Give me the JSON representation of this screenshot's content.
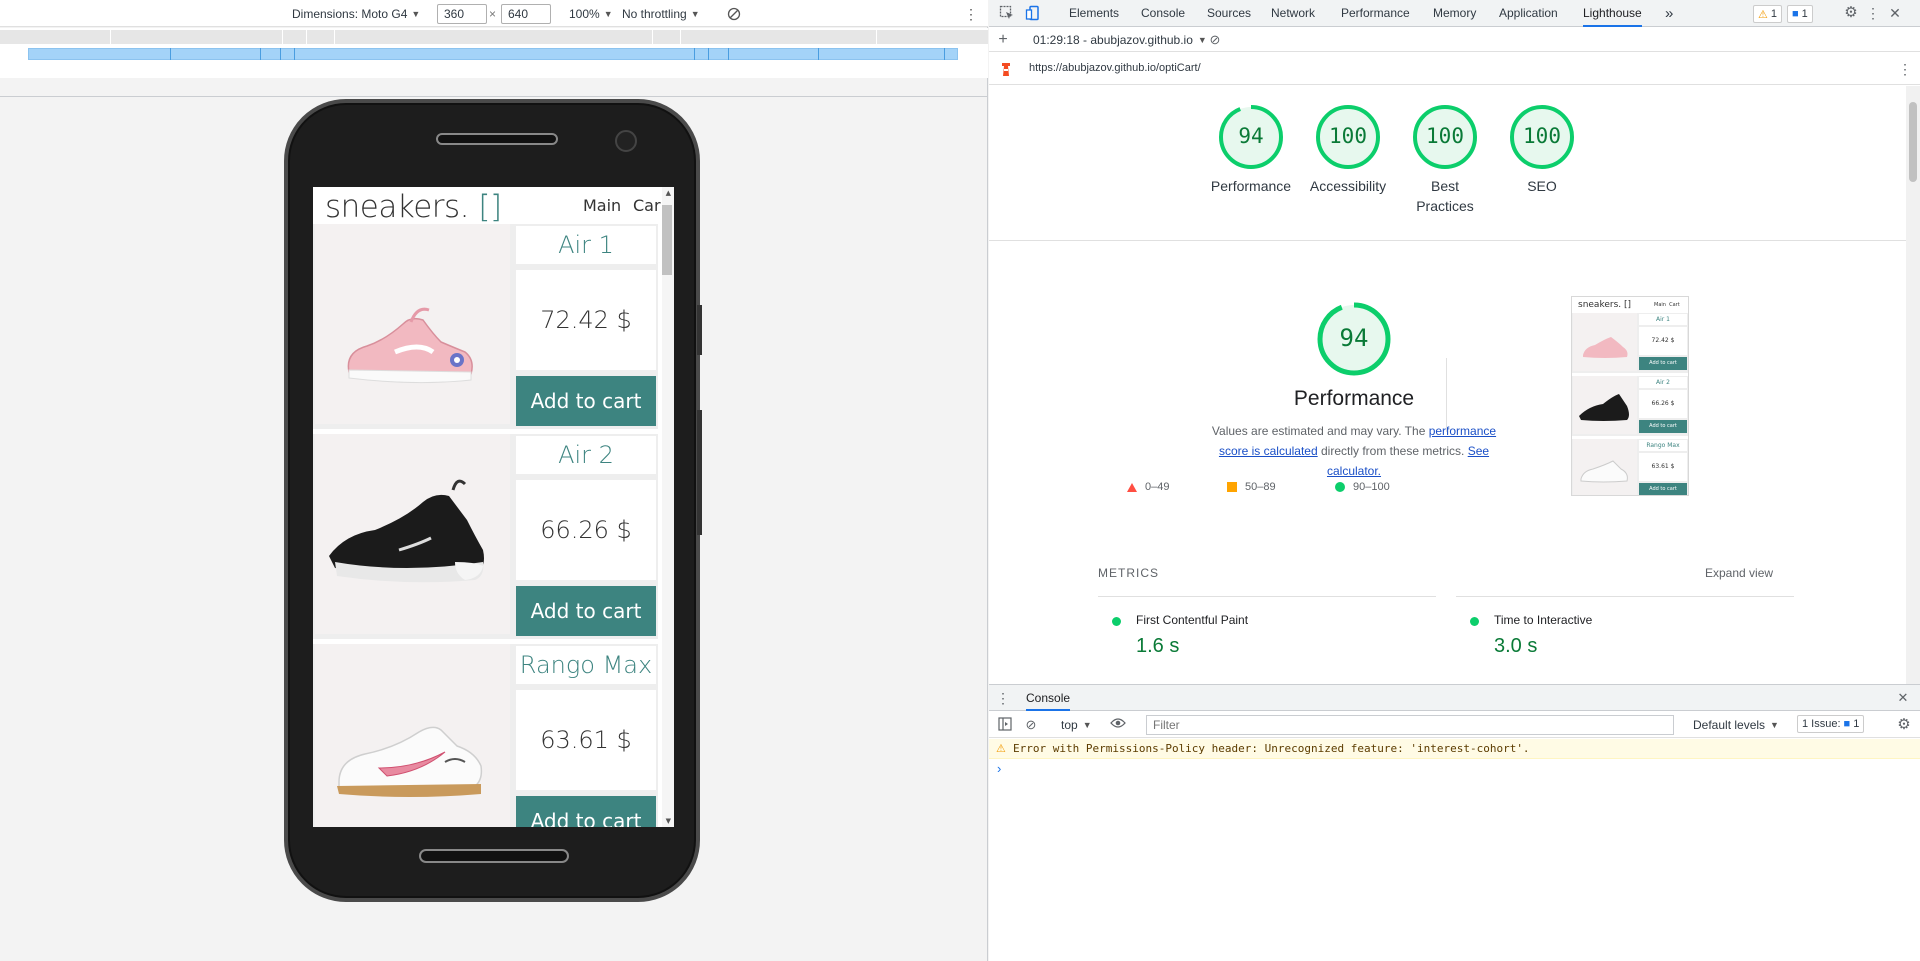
{
  "device_toolbar": {
    "dimensions_label": "Dimensions: Moto G4",
    "width": "360",
    "times": "×",
    "height": "640",
    "zoom": "100%",
    "throttling": "No throttling"
  },
  "site": {
    "logo": "sneakers.",
    "logo_brackets": "[]",
    "nav_main": "Main",
    "nav_cart": "Car",
    "products": [
      {
        "name": "Air 1",
        "price": "72.42 $",
        "button": "Add to cart"
      },
      {
        "name": "Air 2",
        "price": "66.26 $",
        "button": "Add to cart"
      },
      {
        "name": "Rango Max",
        "price": "63.61 $",
        "button": "Add to cart"
      }
    ]
  },
  "devtools": {
    "tabs": [
      "Elements",
      "Console",
      "Sources",
      "Network",
      "Performance",
      "Memory",
      "Application",
      "Lighthouse"
    ],
    "more": "»",
    "warnings_count": "1",
    "messages_count": "1",
    "report_time": "01:29:18 - abubjazov.github.io",
    "report_url": "https://abubjazov.github.io/optiCart/"
  },
  "lighthouse": {
    "gauges": [
      {
        "score": "94",
        "label": "Performance",
        "value": 0.94
      },
      {
        "score": "100",
        "label": "Accessibility",
        "value": 1.0
      },
      {
        "score": "100",
        "label": "Best Practices",
        "value": 1.0
      },
      {
        "score": "100",
        "label": "SEO",
        "value": 1.0
      }
    ],
    "perf_score": "94",
    "perf_title": "Performance",
    "perf_desc_1": "Values are estimated and may vary. The ",
    "perf_link_1": "performance score is calculated",
    "perf_desc_2": " directly from these metrics. ",
    "perf_link_2": "See calculator.",
    "legend": [
      "0–49",
      "50–89",
      "90–100"
    ],
    "metrics_label": "METRICS",
    "expand_view": "Expand view",
    "metrics": [
      {
        "name": "First Contentful Paint",
        "value": "1.6 s"
      },
      {
        "name": "Time to Interactive",
        "value": "3.0 s"
      }
    ],
    "thumbnail": {
      "logo": "sneakers. []",
      "nav": "Main  Cart",
      "items": [
        {
          "name": "Air 1",
          "price": "72.42 $",
          "button": "Add to cart"
        },
        {
          "name": "Air 2",
          "price": "66.26 $",
          "button": "Add to cart"
        },
        {
          "name": "Rango Max",
          "price": "63.61 $",
          "button": "Add to cart"
        }
      ]
    }
  },
  "console": {
    "tab": "Console",
    "context": "top",
    "filter_placeholder": "Filter",
    "levels": "Default levels",
    "issues": "1 Issue:",
    "issues_count": "1",
    "warning": "Error with Permissions-Policy header: Unrecognized feature: 'interest-cohort'.",
    "prompt": "›"
  },
  "colors": {
    "accent": "#3d8480",
    "good": "#0cce6b",
    "average": "#ffa400",
    "fail": "#ff4e42",
    "link": "#1a4fc7"
  }
}
